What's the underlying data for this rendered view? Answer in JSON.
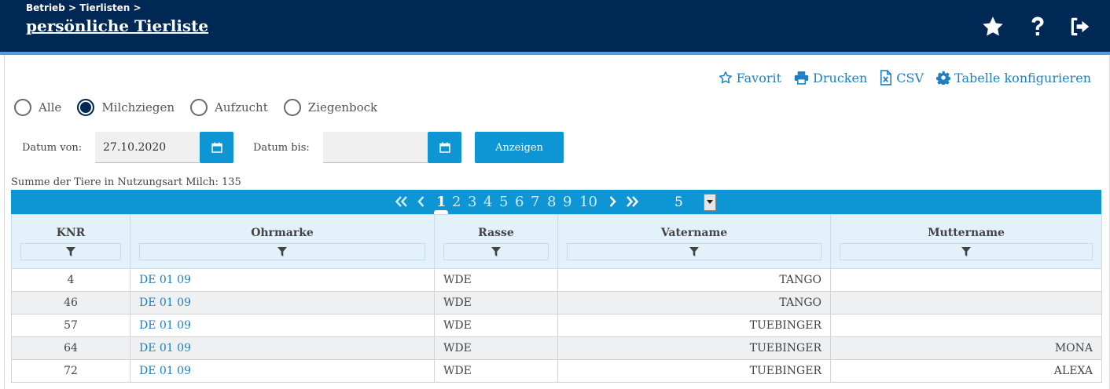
{
  "header": {
    "breadcrumb": "Betrieb > Tierlisten >",
    "title": "persönliche Tierliste",
    "icons": [
      "star-icon",
      "help-icon",
      "logout-icon"
    ]
  },
  "toolbar": {
    "favorit": "Favorit",
    "drucken": "Drucken",
    "csv": "CSV",
    "konfigurieren": "Tabelle konfigurieren"
  },
  "filters": {
    "radios": [
      {
        "label": "Alle",
        "checked": false
      },
      {
        "label": "Milchziegen",
        "checked": true
      },
      {
        "label": "Aufzucht",
        "checked": false
      },
      {
        "label": "Ziegenbock",
        "checked": false
      }
    ],
    "date_from_label": "Datum von:",
    "date_from_value": "27.10.2020",
    "date_to_label": "Datum bis:",
    "date_to_value": "",
    "show_button": "Anzeigen"
  },
  "summary": "Summe der Tiere in Nutzungsart Milch: 135",
  "pager": {
    "pages": [
      "1",
      "2",
      "3",
      "4",
      "5",
      "6",
      "7",
      "8",
      "9",
      "10"
    ],
    "current": "1",
    "page_size": "5"
  },
  "table": {
    "columns": [
      "KNR",
      "Ohrmarke",
      "Rasse",
      "Vatername",
      "Muttername"
    ],
    "rows": [
      {
        "knr": "4",
        "ohrmarke": "DE 01 09",
        "rasse": "WDE",
        "vater": "TANGO",
        "mutter": ""
      },
      {
        "knr": "46",
        "ohrmarke": "DE 01 09",
        "rasse": "WDE",
        "vater": "TANGO",
        "mutter": ""
      },
      {
        "knr": "57",
        "ohrmarke": "DE 01 09",
        "rasse": "WDE",
        "vater": "TUEBINGER",
        "mutter": ""
      },
      {
        "knr": "64",
        "ohrmarke": "DE 01 09",
        "rasse": "WDE",
        "vater": "TUEBINGER",
        "mutter": "MONA"
      },
      {
        "knr": "72",
        "ohrmarke": "DE 01 09",
        "rasse": "WDE",
        "vater": "TUEBINGER",
        "mutter": "ALEXA"
      }
    ]
  },
  "colors": {
    "header_bg": "#002855",
    "accent": "#0e95d3",
    "link": "#1e7fc4",
    "table_header_bg": "#e3f1fa"
  }
}
